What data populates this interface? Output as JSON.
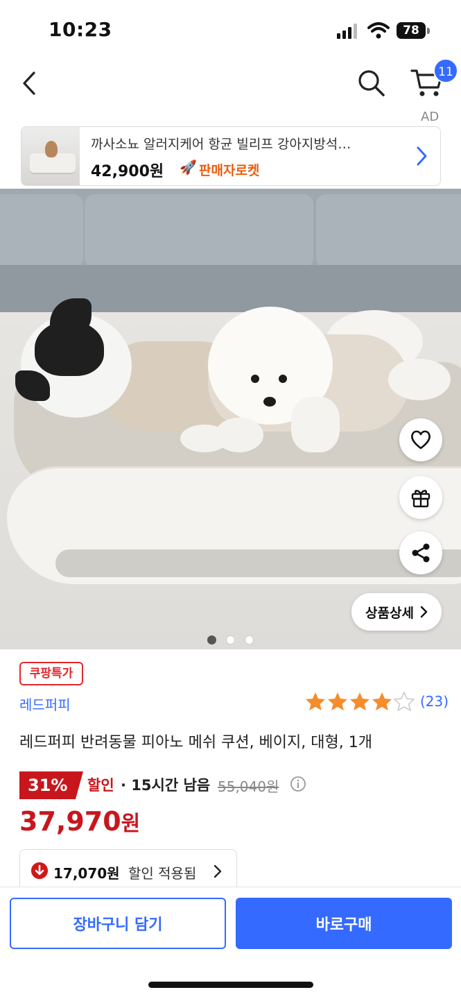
{
  "status_bar": {
    "time": "10:23",
    "battery": "78"
  },
  "nav": {
    "cart_count": "11",
    "ad_label": "AD"
  },
  "ad_banner": {
    "title": "까사소뇨 알러지케어 항균 빌리프 강아지방석…",
    "price": "42,900원",
    "seller_badge": "판매자로켓",
    "seller_icon": "🚀"
  },
  "gallery": {
    "detail_button": "상품상세",
    "dots": 3,
    "active_dot": 0
  },
  "product": {
    "deal_badge": "쿠팡특가",
    "brand": "레드퍼피",
    "rating": 4,
    "rating_max": 5,
    "review_count": "(23)",
    "name": "레드퍼피 반려동물 피아노 메쉬 쿠션, 베이지, 대형, 1개"
  },
  "price": {
    "discount_rate": "31%",
    "discount_label": "할인",
    "time_left": "· 15시간 남음",
    "original_price": "55,040원",
    "sale_price": "37,970",
    "sale_unit": "원"
  },
  "coupon": {
    "amount": "17,070원",
    "label": "할인 적용됨"
  },
  "actions": {
    "cart_button": "장바구니 담기",
    "buy_button": "바로구매"
  },
  "colors": {
    "accent": "#346aff",
    "sale_red": "#c8161d",
    "star": "#f58d2d"
  },
  "icons": [
    "back-icon",
    "search-icon",
    "cart-icon",
    "heart-icon",
    "gift-icon",
    "share-icon",
    "info-icon",
    "chevron-right-icon",
    "arrow-down-icon"
  ]
}
